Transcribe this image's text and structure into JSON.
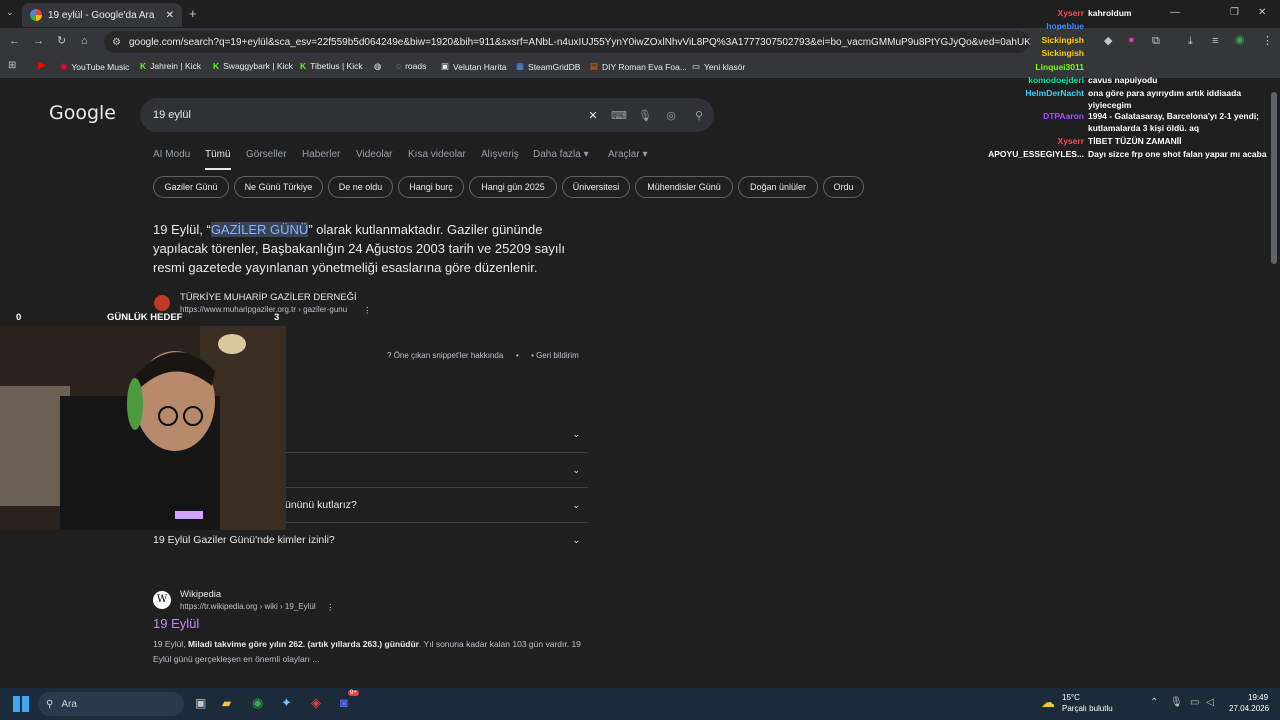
{
  "browser": {
    "tab_title": "19 eylül - Google'da Ara",
    "url": "google.com/search?q=19+eylül&sca_esv=22f559b5d064249e&biw=1920&bih=911&sxsrf=ANbL-n4uxIUJ55YynY0iwZOxlNhvViL8PQ%3A1777307502793&ei=bo_vacmGMMuP9u8PtYGJyQo&ved=0ahUKEwj9fCyuo6UAx..."
  },
  "bookmarks": [
    "YouTube Music",
    "Jahrein | Kick",
    "Swaggybark | Kick",
    "Tibetius | Kick",
    "roads",
    "Velutan Harita",
    "SteamGridDB",
    "DIY Roman Eva Foa...",
    "Yeni klasör"
  ],
  "google": {
    "logo": "Google",
    "query": "19 eylül",
    "tabs": [
      "AI Modu",
      "Tümü",
      "Görseller",
      "Haberler",
      "Videolar",
      "Kısa videolar",
      "Alışveriş",
      "Daha fazla",
      "Araçlar"
    ],
    "active_tab": "Tümü",
    "chips": [
      "Gaziler Günü",
      "Ne Günü Türkiye",
      "De ne oldu",
      "Hangi burç",
      "Hangi gün 2025",
      "Üniversitesi",
      "Mühendisler Günü",
      "Doğan ünlüler",
      "Ordu"
    ],
    "snippet": {
      "pre": "19 Eylül, “",
      "highlight": "GAZİLER GÜNÜ",
      "post": "” olarak kutlanmaktadır. Gaziler gününde yapılacak törenler, Başbakanlığın 24 Ağustos 2003 tarih ve 25209 sayılı resmi gazetede yayınlanan yönetmeliği esaslarına göre düzenlenir.",
      "source_name": "TÜRKİYE MUHARİP GAZİLER DERNEĞİ",
      "source_url": "https://www.muharipgaziler.org.tr › gaziler-gunu",
      "about": "Öne çıkan snippet'ler hakkında",
      "feedback": "Geri bildirim"
    },
    "faq": [
      "ününü kutlarız?",
      "19 Eylül Gaziler Günü'nde kimler izinli?"
    ],
    "result": {
      "site": "Wikipedia",
      "url": "https://tr.wikipedia.org › wiki › 19_Eylül",
      "title": "19 Eylül",
      "desc_pre": "19 Eylül, ",
      "desc_bold": "Miladi takvime göre yılın 262. (artık yıllarda 263.) günüdür",
      "desc_post": ". Yıl sonuna kadar kalan 103 gün vardır. 19 Eylül günü gerçekleşen en önemli olayları ..."
    }
  },
  "overlay": {
    "count_left": "0",
    "label": "GÜNLÜK HEDEF",
    "count_right": "3"
  },
  "chat": [
    {
      "user": "Xyserr",
      "color": "#ff4d4d",
      "msg": "kahroldum"
    },
    {
      "user": "hopeblue",
      "color": "#3a8cff",
      "msg": ""
    },
    {
      "user": "Sickingish",
      "color": "#ffcc00",
      "msg": ""
    },
    {
      "user": "Sickingish",
      "color": "#ffcc00",
      "msg": ""
    },
    {
      "user": "Linquei3011",
      "color": "#7cfc00",
      "msg": ""
    },
    {
      "user": "komodoejderi",
      "color": "#00e5a0",
      "msg": "cavus napuiyodu"
    },
    {
      "user": "HelmDerNacht",
      "color": "#3ad0ff",
      "msg": "ona göre para ayırıydım artık iddiaada"
    },
    {
      "user": "",
      "color": "#fff",
      "msg": "yiyiecegim"
    },
    {
      "user": "DTPAaron",
      "color": "#a64dff",
      "msg": "1994 - Galatasaray, Barcelona'yı 2-1 yendi;"
    },
    {
      "user": "",
      "color": "#fff",
      "msg": "kutlamalarda 3 kişi öldü. aq"
    },
    {
      "user": "Xyserr",
      "color": "#ff4d4d",
      "msg": "TİBET TÜZÜN ZAMANİİ"
    },
    {
      "user": "APOYU_ESSEGIYLES...",
      "color": "#ffffff",
      "msg": "Dayı sizce frp one shot falan yapar mı acaba"
    }
  ],
  "taskbar": {
    "search": "Ara",
    "weather_temp": "15°C",
    "weather_desc": "Parçalı bulutlu",
    "time": "19:49",
    "date": "27.04.2026",
    "badge": "9+"
  }
}
